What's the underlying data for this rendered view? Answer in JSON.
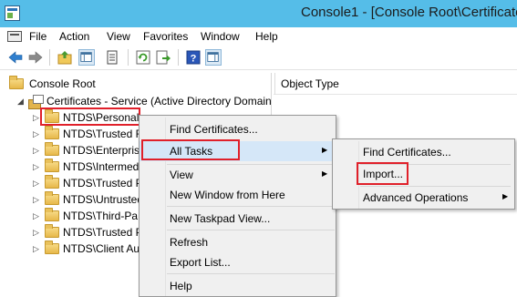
{
  "window": {
    "title": "Console1 - [Console Root\\Certificate"
  },
  "menubar": {
    "items": [
      "File",
      "Action",
      "View",
      "Favorites",
      "Window",
      "Help"
    ]
  },
  "toolbar": {
    "buttons": [
      "back-icon",
      "forward-icon",
      "up-folder-icon",
      "show-hide-tree-icon",
      "properties-icon",
      "refresh-icon",
      "export-list-icon",
      "help-icon",
      "action-pane-icon"
    ]
  },
  "tree": {
    "root": "Console Root",
    "store": "Certificates - Service (Active Directory Domain",
    "folders": [
      "NTDS\\Personal",
      "NTDS\\Trusted R",
      "NTDS\\Enterpris",
      "NTDS\\Intermed",
      "NTDS\\Trusted P",
      "NTDS\\Untrusted",
      "NTDS\\Third-Pa",
      "NTDS\\Trusted P",
      "NTDS\\Client Au"
    ]
  },
  "list": {
    "column_header": "Object Type"
  },
  "context_menu": {
    "items": [
      "Find Certificates...",
      "All Tasks",
      "View",
      "New Window from Here",
      "New Taskpad View...",
      "Refresh",
      "Export List...",
      "Help"
    ]
  },
  "submenu": {
    "items": [
      "Find Certificates...",
      "Import...",
      "Advanced Operations"
    ]
  },
  "colors": {
    "titlebar": "#55bde8",
    "highlight_box": "#e0202a",
    "menu_hover": "#d5e7f8"
  }
}
